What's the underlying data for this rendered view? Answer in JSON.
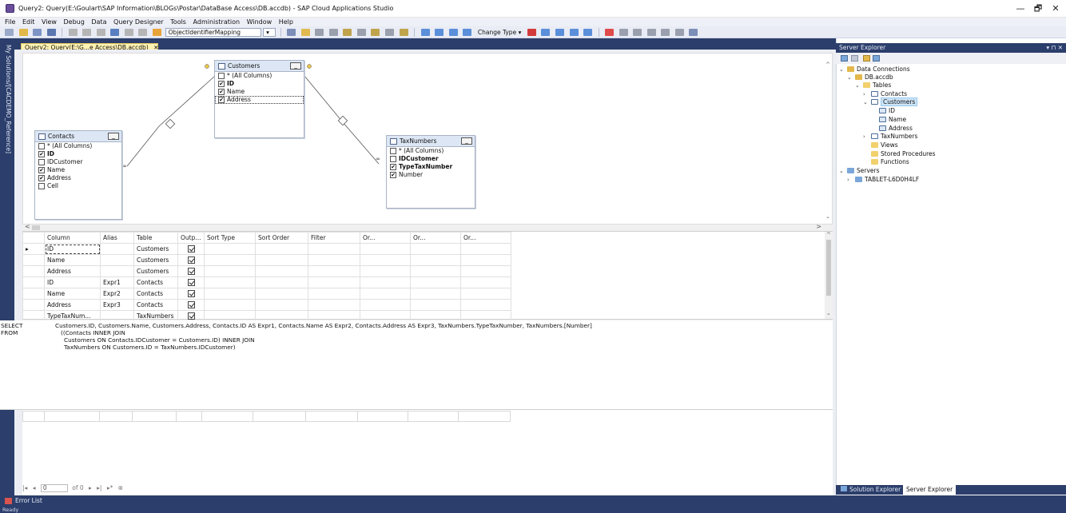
{
  "window": {
    "title": "Query2: Query(E:\\Goulart\\SAP Information\\BLOGs\\Postar\\DataBase Access\\DB.accdb) - SAP Cloud Applications Studio",
    "minimize": "—",
    "maximize": "🗗",
    "close": "✕"
  },
  "menu": [
    "File",
    "Edit",
    "View",
    "Debug",
    "Data",
    "Query Designer",
    "Tools",
    "Administration",
    "Window",
    "Help"
  ],
  "toolbar": {
    "combo_value": "ObjectIdentifierMapping",
    "change_type_label": "Change Type ▾"
  },
  "left_rail": "My Solutions/[CACDEMO_Reference]",
  "doc_tab": {
    "label": "Query2: Query(E:\\G...e Access\\DB.accdb)",
    "close": "✕"
  },
  "diagram": {
    "tables": [
      {
        "name": "Contacts",
        "rows": [
          {
            "label": "* (All Columns)",
            "checked": false,
            "bold": false
          },
          {
            "label": "ID",
            "checked": true,
            "bold": true
          },
          {
            "label": "IDCustomer",
            "checked": false,
            "bold": false
          },
          {
            "label": "Name",
            "checked": true,
            "bold": false
          },
          {
            "label": "Address",
            "checked": true,
            "bold": false
          },
          {
            "label": "Cell",
            "checked": false,
            "bold": false
          }
        ]
      },
      {
        "name": "Customers",
        "rows": [
          {
            "label": "* (All Columns)",
            "checked": false,
            "bold": false
          },
          {
            "label": "ID",
            "checked": true,
            "bold": true
          },
          {
            "label": "Name",
            "checked": true,
            "bold": false
          },
          {
            "label": "Address",
            "checked": true,
            "bold": false
          }
        ]
      },
      {
        "name": "TaxNumbers",
        "rows": [
          {
            "label": "* (All Columns)",
            "checked": false,
            "bold": false
          },
          {
            "label": "IDCustomer",
            "checked": false,
            "bold": true
          },
          {
            "label": "TypeTaxNumber",
            "checked": true,
            "bold": true
          },
          {
            "label": "Number",
            "checked": true,
            "bold": false
          }
        ]
      }
    ]
  },
  "grid": {
    "headers": [
      "Column",
      "Alias",
      "Table",
      "Outp...",
      "Sort Type",
      "Sort Order",
      "Filter",
      "Or...",
      "Or...",
      "Or..."
    ],
    "rows": [
      {
        "column": "ID",
        "alias": "",
        "table": "Customers",
        "output": true
      },
      {
        "column": "Name",
        "alias": "",
        "table": "Customers",
        "output": true
      },
      {
        "column": "Address",
        "alias": "",
        "table": "Customers",
        "output": true
      },
      {
        "column": "ID",
        "alias": "Expr1",
        "table": "Contacts",
        "output": true
      },
      {
        "column": "Name",
        "alias": "Expr2",
        "table": "Contacts",
        "output": true
      },
      {
        "column": "Address",
        "alias": "Expr3",
        "table": "Contacts",
        "output": true
      },
      {
        "column": "TypeTaxNum...",
        "alias": "",
        "table": "TaxNumbers",
        "output": true
      }
    ]
  },
  "sql": {
    "kw_select": "SELECT",
    "kw_from": "FROM",
    "select_list": "Customers.ID, Customers.Name, Customers.Address, Contacts.ID AS Expr1, Contacts.Name AS Expr2, Contacts.Address AS Expr3, TaxNumbers.TypeTaxNumber, TaxNumbers.[Number]",
    "from_lines": [
      "((Contacts INNER JOIN",
      "Customers ON Contacts.IDCustomer = Customers.ID) INNER JOIN",
      "TaxNumbers ON Customers.ID = TaxNumbers.IDCustomer)"
    ]
  },
  "navigator": {
    "page_value": "0",
    "of_label": "of 0"
  },
  "server_explorer": {
    "title": "Server Explorer",
    "pin": "▾ ⊓ ✕",
    "nodes": [
      {
        "label": "Data Connections",
        "expander": "⌄",
        "icon": "data-connections-icon"
      },
      {
        "label": "DB.accdb",
        "expander": "⌄",
        "icon": "database-icon"
      },
      {
        "label": "Tables",
        "expander": "⌄",
        "icon": "folder-icon"
      },
      {
        "label": "Contacts",
        "expander": "›",
        "icon": "table-icon"
      },
      {
        "label": "Customers",
        "expander": "⌄",
        "icon": "table-icon"
      },
      {
        "label": "ID",
        "expander": "",
        "icon": "column-icon"
      },
      {
        "label": "Name",
        "expander": "",
        "icon": "column-icon"
      },
      {
        "label": "Address",
        "expander": "",
        "icon": "column-icon"
      },
      {
        "label": "TaxNumbers",
        "expander": "›",
        "icon": "table-icon"
      },
      {
        "label": "Views",
        "expander": "",
        "icon": "folder-icon"
      },
      {
        "label": "Stored Procedures",
        "expander": "",
        "icon": "folder-icon"
      },
      {
        "label": "Functions",
        "expander": "",
        "icon": "folder-icon"
      },
      {
        "label": "Servers",
        "expander": "⌄",
        "icon": "servers-icon"
      },
      {
        "label": "TABLET-L6D0H4LF",
        "expander": "›",
        "icon": "server-icon"
      }
    ]
  },
  "bottom_tabs": {
    "solution_explorer": "Solution Explorer",
    "server_explorer": "Server Explorer"
  },
  "error_list": "Error List",
  "status": "Ready",
  "colors": {
    "accent": "#2c3e6b",
    "doc_tab": "#fff2b3",
    "table_header": "#dce6f4",
    "selected": "#cce4f7"
  }
}
